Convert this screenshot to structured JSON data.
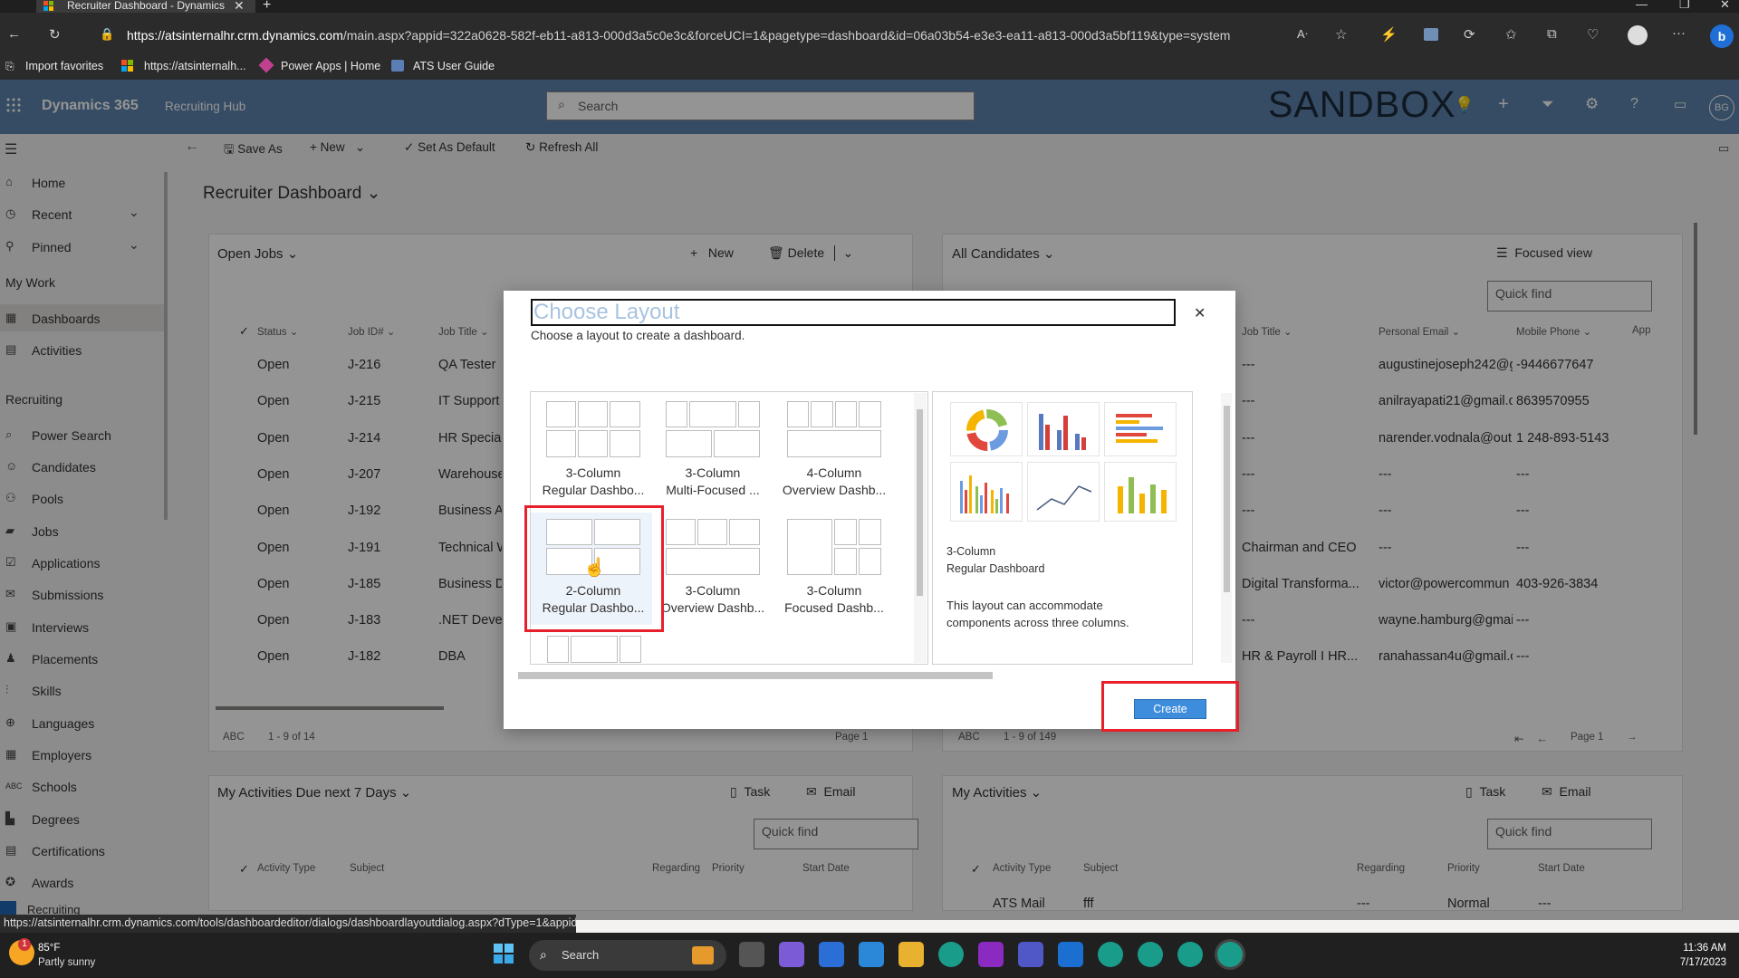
{
  "browser": {
    "tab_title": "Recruiter Dashboard - Dynamics",
    "url_host": "https://atsinternalhr.crm.dynamics.com",
    "url_rest": "/main.aspx?appid=322a0628-582f-eb11-a813-000d3a5c0e3c&forceUCI=1&pagetype=dashboard&id=06a03b54-e3e3-ea11-a813-000d3a5bf119&type=system",
    "favorites": [
      "Import favorites",
      "https://atsinternalh...",
      "Power Apps | Home",
      "ATS User Guide"
    ]
  },
  "app": {
    "name": "Dynamics 365",
    "area": "Recruiting Hub",
    "search_placeholder": "Search",
    "env_label": "SANDBOX",
    "avatar": "BG"
  },
  "cmdbar": {
    "save_as": "Save As",
    "new": "New",
    "set_default": "Set As Default",
    "refresh": "Refresh All"
  },
  "sidebar": {
    "home": "Home",
    "recent": "Recent",
    "pinned": "Pinned",
    "group_work": "My Work",
    "dashboards": "Dashboards",
    "activities": "Activities",
    "group_recruiting": "Recruiting",
    "items": [
      "Power Search",
      "Candidates",
      "Pools",
      "Jobs",
      "Applications",
      "Submissions",
      "Interviews",
      "Placements",
      "Skills",
      "Languages",
      "Employers",
      "Schools",
      "Degrees",
      "Certifications",
      "Awards"
    ],
    "bottom": "Recruiting"
  },
  "dashboard": {
    "title": "Recruiter Dashboard",
    "jobs": {
      "title": "Open Jobs",
      "new": "New",
      "delete": "Delete",
      "cols": [
        "Status",
        "Job ID#",
        "Job Title"
      ],
      "rows": [
        [
          "Open",
          "J-216",
          "QA Tester"
        ],
        [
          "Open",
          "J-215",
          "IT Support"
        ],
        [
          "Open",
          "J-214",
          "HR Speciali"
        ],
        [
          "Open",
          "J-207",
          "Warehouse"
        ],
        [
          "Open",
          "J-192",
          "Business Ar"
        ],
        [
          "Open",
          "J-191",
          "Technical W"
        ],
        [
          "Open",
          "J-185",
          "Business De"
        ],
        [
          "Open",
          "J-183",
          ".NET Develo"
        ],
        [
          "Open",
          "J-182",
          "DBA"
        ]
      ],
      "abc": "ABC",
      "range": "1 - 9 of 14",
      "page": "Page 1"
    },
    "candidates": {
      "title": "All Candidates",
      "focused": "Focused view",
      "quickfind": "Quick find",
      "cols": [
        "Job Title",
        "Personal Email",
        "Mobile Phone",
        "App"
      ],
      "rows": [
        [
          "---",
          "augustinejoseph242@g",
          "-9446677647"
        ],
        [
          "---",
          "anilrayapati21@gmail.c",
          "8639570955"
        ],
        [
          "---",
          "narender.vodnala@out",
          "1 248-893-5143"
        ],
        [
          "---",
          "---",
          "---"
        ],
        [
          "---",
          "---",
          "---"
        ],
        [
          "Chairman and CEO",
          "---",
          "---"
        ],
        [
          "Digital Transforma...",
          "victor@powercommun",
          "403-926-3834"
        ],
        [
          "---",
          "wayne.hamburg@gmai",
          "---"
        ],
        [
          "HR & Payroll I HR...",
          "ranahassan4u@gmail.c",
          "---"
        ]
      ],
      "abc": "ABC",
      "range": "1 - 9 of 149",
      "page": "Page 1"
    },
    "activities7": {
      "title": "My Activities Due next 7 Days",
      "task": "Task",
      "email": "Email",
      "quickfind": "Quick find",
      "cols": [
        "Activity Type",
        "Subject",
        "Regarding",
        "Priority",
        "Start Date"
      ]
    },
    "myact": {
      "title": "My Activities",
      "task": "Task",
      "email": "Email",
      "quickfind": "Quick find",
      "cols": [
        "Activity Type",
        "Subject",
        "Regarding",
        "Priority",
        "Start Date"
      ],
      "row": [
        "ATS Mail",
        "fff",
        "---",
        "Normal",
        "---"
      ]
    }
  },
  "modal": {
    "title": "Choose Layout",
    "subtitle": "Choose a layout to create a dashboard.",
    "layouts": [
      {
        "l1": "3-Column",
        "l2": "Regular Dashbo..."
      },
      {
        "l1": "3-Column",
        "l2": "Multi-Focused ..."
      },
      {
        "l1": "4-Column",
        "l2": "Overview Dashb..."
      },
      {
        "l1": "2-Column",
        "l2": "Regular Dashbo..."
      },
      {
        "l1": "3-Column",
        "l2": "Overview Dashb..."
      },
      {
        "l1": "3-Column",
        "l2": "Focused Dashb..."
      }
    ],
    "preview": {
      "title1": "3-Column",
      "title2": "Regular Dashboard",
      "desc": "This layout can accommodate components across three columns."
    },
    "create": "Create"
  },
  "status_url": "https://atsinternalhr.crm.dynamics.com/tools/dashboardeditor/dialogs/dashboardlayoutdialog.aspx?dType=1&appid...",
  "taskbar": {
    "temp": "85°F",
    "weather": "Partly sunny",
    "search": "Search",
    "time": "11:36 AM",
    "date": "7/17/2023",
    "badge": "1"
  }
}
